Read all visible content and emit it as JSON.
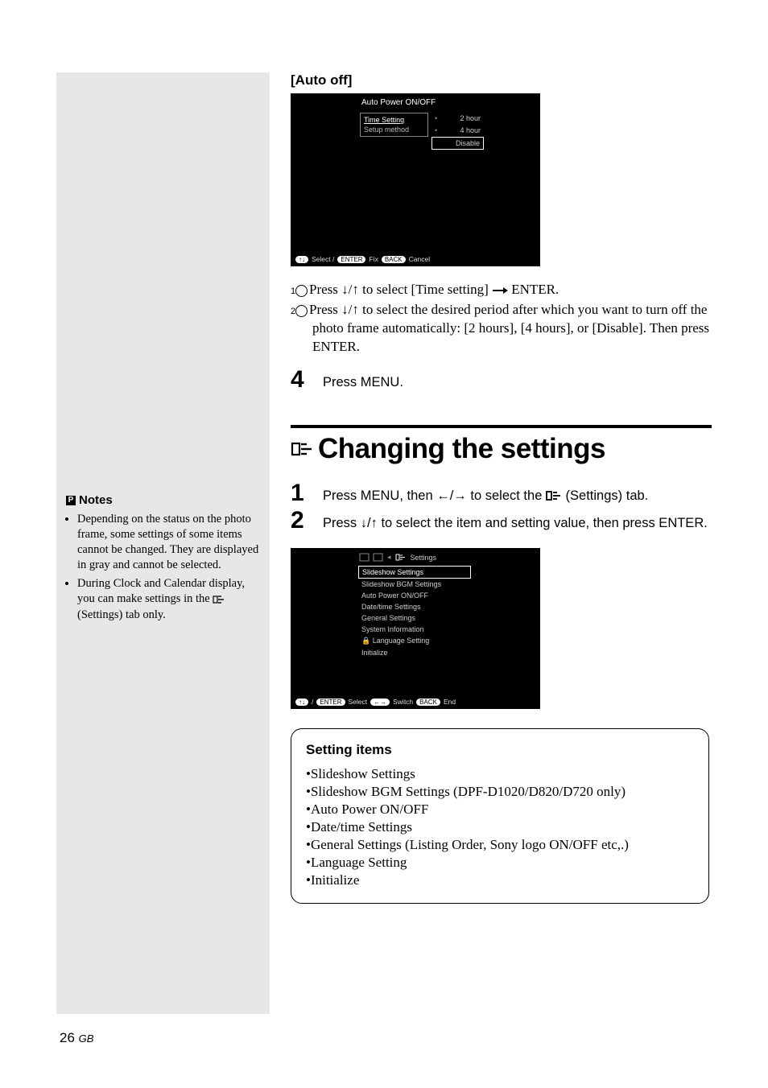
{
  "auto_off": {
    "heading": "[Auto off]",
    "screenshot": {
      "title": "Auto Power ON/OFF",
      "menu_items": [
        "Time Setting",
        "Setup method"
      ],
      "options": [
        "2 hour",
        "4 hour",
        "Disable"
      ],
      "bottombar": {
        "arrows": "↑↓",
        "select": "Select /",
        "enter": "ENTER",
        "fix": "Fix",
        "back": "BACK",
        "cancel": "Cancel"
      }
    },
    "instructions": {
      "line1_a": "Press ",
      "line1_b": " to select [Time setting] ",
      "line1_c": " ENTER.",
      "line2_a": "Press ",
      "line2_b": " to select the desired period after which you want to turn off the photo frame automatically: [2 hours], [4 hours], or [Disable].  Then press ENTER."
    },
    "step4": "Press MENU."
  },
  "changing": {
    "title": "Changing the settings",
    "step1_a": "Press MENU, then ",
    "step1_b": " to select the ",
    "step1_c": " (Settings) tab.",
    "step2_a": "Press ",
    "step2_b": " to select the item and setting value, then press ENTER.",
    "screenshot": {
      "tabs_label": "Settings",
      "items": [
        "Slideshow Settings",
        "Slideshow BGM Settings",
        "Auto Power ON/OFF",
        "Date/time Settings",
        "General Settings",
        "System Information",
        "Language Setting",
        "Initialize"
      ],
      "bottombar": {
        "arrows": "↑↓",
        "slash": "/",
        "enter": "ENTER",
        "select": "Select",
        "lr": "←→",
        "switch": "Switch",
        "back": "BACK",
        "end": "End"
      }
    }
  },
  "setting_items": {
    "heading": "Setting items",
    "items": [
      "Slideshow Settings",
      "Slideshow BGM Settings (DPF-D1020/D820/D720 only)",
      "Auto Power ON/OFF",
      "Date/time Settings",
      "General Settings (Listing Order, Sony logo ON/OFF etc,.)",
      "Language Setting",
      "Initialize"
    ]
  },
  "notes": {
    "heading": "Notes",
    "bullets": [
      "Depending on the status on the photo frame, some settings of some items cannot be changed. They are displayed in gray and cannot be selected.",
      "During Clock and Calendar display, you can make settings in the    (Settings) tab only."
    ]
  },
  "footer": {
    "page": "26",
    "gb": "GB"
  },
  "glyphs": {
    "down_up": "↓/↑",
    "left_right": "←/→"
  }
}
